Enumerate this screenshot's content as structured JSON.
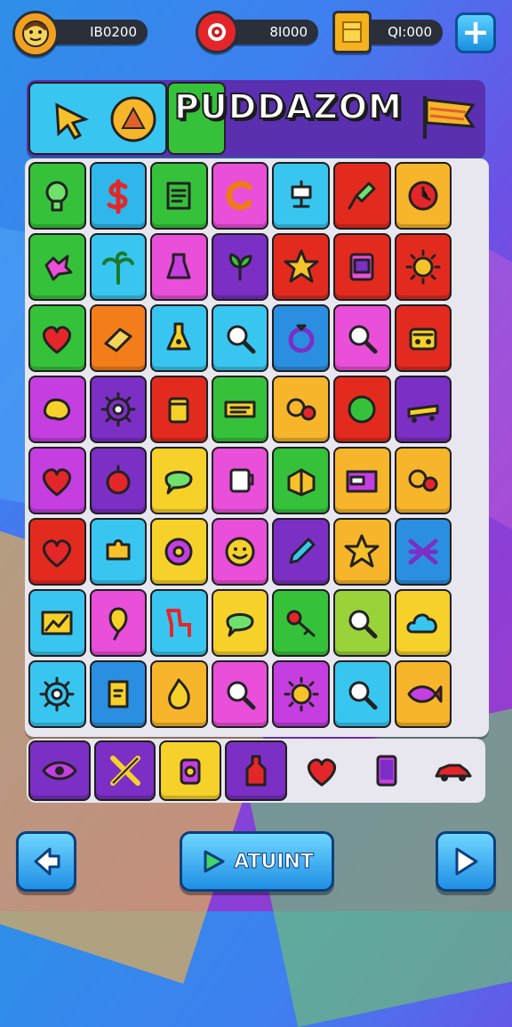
{
  "hud": {
    "player_value": "IB0200",
    "gems_value": "8I000",
    "gold_value": "QI:000",
    "add_label": "+"
  },
  "header": {
    "title": "PUDDAZOM"
  },
  "board": {
    "tiles": [
      {
        "color": "#35c23a",
        "icon": "gear-bulb-icon"
      },
      {
        "color": "#2fb6ea",
        "icon": "dollar-icon"
      },
      {
        "color": "#35c23a",
        "icon": "document-icon"
      },
      {
        "color": "#e94fd8",
        "icon": "letter-c-icon"
      },
      {
        "color": "#38c6f0",
        "icon": "robot-icon"
      },
      {
        "color": "#e32a1f",
        "icon": "wrench-icon"
      },
      {
        "color": "#f6b52a",
        "icon": "clock-icon"
      },
      {
        "color": "#35c23a",
        "icon": "splat-icon"
      },
      {
        "color": "#38c6f0",
        "icon": "palm-tree-icon"
      },
      {
        "color": "#e94fd8",
        "icon": "potion-icon"
      },
      {
        "color": "#7b2fc4",
        "icon": "sprout-icon"
      },
      {
        "color": "#e32a1f",
        "icon": "star-burst-icon"
      },
      {
        "color": "#e32a1f",
        "icon": "phone-card-icon"
      },
      {
        "color": "#e32a1f",
        "icon": "sun-icon"
      },
      {
        "color": "#35c23a",
        "icon": "heart-icon"
      },
      {
        "color": "#f37d1a",
        "icon": "eraser-icon"
      },
      {
        "color": "#38c6f0",
        "icon": "flask-icon"
      },
      {
        "color": "#38c6f0",
        "icon": "magnifier-icon"
      },
      {
        "color": "#2a8fe0",
        "icon": "ring-icon"
      },
      {
        "color": "#e94fd8",
        "icon": "magnifier-icon"
      },
      {
        "color": "#e32a1f",
        "icon": "radio-icon"
      },
      {
        "color": "#c43ee0",
        "icon": "blob-icon"
      },
      {
        "color": "#7b2fc4",
        "icon": "gear-icon"
      },
      {
        "color": "#e32a1f",
        "icon": "jar-icon"
      },
      {
        "color": "#35c23a",
        "icon": "ticket-icon"
      },
      {
        "color": "#f6b52a",
        "icon": "gears-icon"
      },
      {
        "color": "#e32a1f",
        "icon": "ball-icon"
      },
      {
        "color": "#7b2fc4",
        "icon": "skateboard-icon"
      },
      {
        "color": "#c43ee0",
        "icon": "heart-icon"
      },
      {
        "color": "#7b2fc4",
        "icon": "berry-icon"
      },
      {
        "color": "#f6d12a",
        "icon": "speech-icon"
      },
      {
        "color": "#e94fd8",
        "icon": "cup-icon"
      },
      {
        "color": "#35c23a",
        "icon": "box-icon"
      },
      {
        "color": "#f6b52a",
        "icon": "card-icon"
      },
      {
        "color": "#f6b52a",
        "icon": "gears-icon"
      },
      {
        "color": "#e32a1f",
        "icon": "heart-icon"
      },
      {
        "color": "#38c6f0",
        "icon": "puzzle-icon"
      },
      {
        "color": "#f6d12a",
        "icon": "donut-icon"
      },
      {
        "color": "#e94fd8",
        "icon": "smiley-icon"
      },
      {
        "color": "#7b2fc4",
        "icon": "pencil-icon"
      },
      {
        "color": "#f6b52a",
        "icon": "star-burst-icon"
      },
      {
        "color": "#2a8fe0",
        "icon": "cross-icon"
      },
      {
        "color": "#38c6f0",
        "icon": "chart-icon"
      },
      {
        "color": "#e94fd8",
        "icon": "balloon-icon"
      },
      {
        "color": "#38c6f0",
        "icon": "chair-icon"
      },
      {
        "color": "#f6d12a",
        "icon": "speech-icon"
      },
      {
        "color": "#35c23a",
        "icon": "key-icon"
      },
      {
        "color": "#9ad23a",
        "icon": "magnifier-icon"
      },
      {
        "color": "#f6d12a",
        "icon": "cloud-icon"
      },
      {
        "color": "#38c6f0",
        "icon": "gear-icon"
      },
      {
        "color": "#2a8fe0",
        "icon": "tag-icon"
      },
      {
        "color": "#f6b52a",
        "icon": "flame-icon"
      },
      {
        "color": "#e94fd8",
        "icon": "magnifier-icon"
      },
      {
        "color": "#c43ee0",
        "icon": "sun-icon"
      },
      {
        "color": "#38c6f0",
        "icon": "magnifier-icon"
      },
      {
        "color": "#f6b52a",
        "icon": "fish-icon"
      }
    ],
    "tray": [
      {
        "color": "#7b2fc4",
        "icon": "eye-icon"
      },
      {
        "color": "#7b2fc4",
        "icon": "tools-icon"
      },
      {
        "color": "#f6d12a",
        "icon": "lantern-icon"
      },
      {
        "color": "#7b2fc4",
        "icon": "bottle-icon"
      },
      {
        "color": "#e8e6ee",
        "icon": "heart-icon"
      },
      {
        "color": "#e8e6ee",
        "icon": "phone-icon"
      },
      {
        "color": "#e8e6ee",
        "icon": "car-icon"
      }
    ]
  },
  "footer": {
    "back_icon": "arrow-left-icon",
    "main_label": "ATUINT",
    "play_icon": "play-icon",
    "next_icon": "play-icon"
  },
  "colors": {
    "accent": "#1f8fe4",
    "banner": "#5a2fb0",
    "board_bg": "#e8e6ee"
  }
}
